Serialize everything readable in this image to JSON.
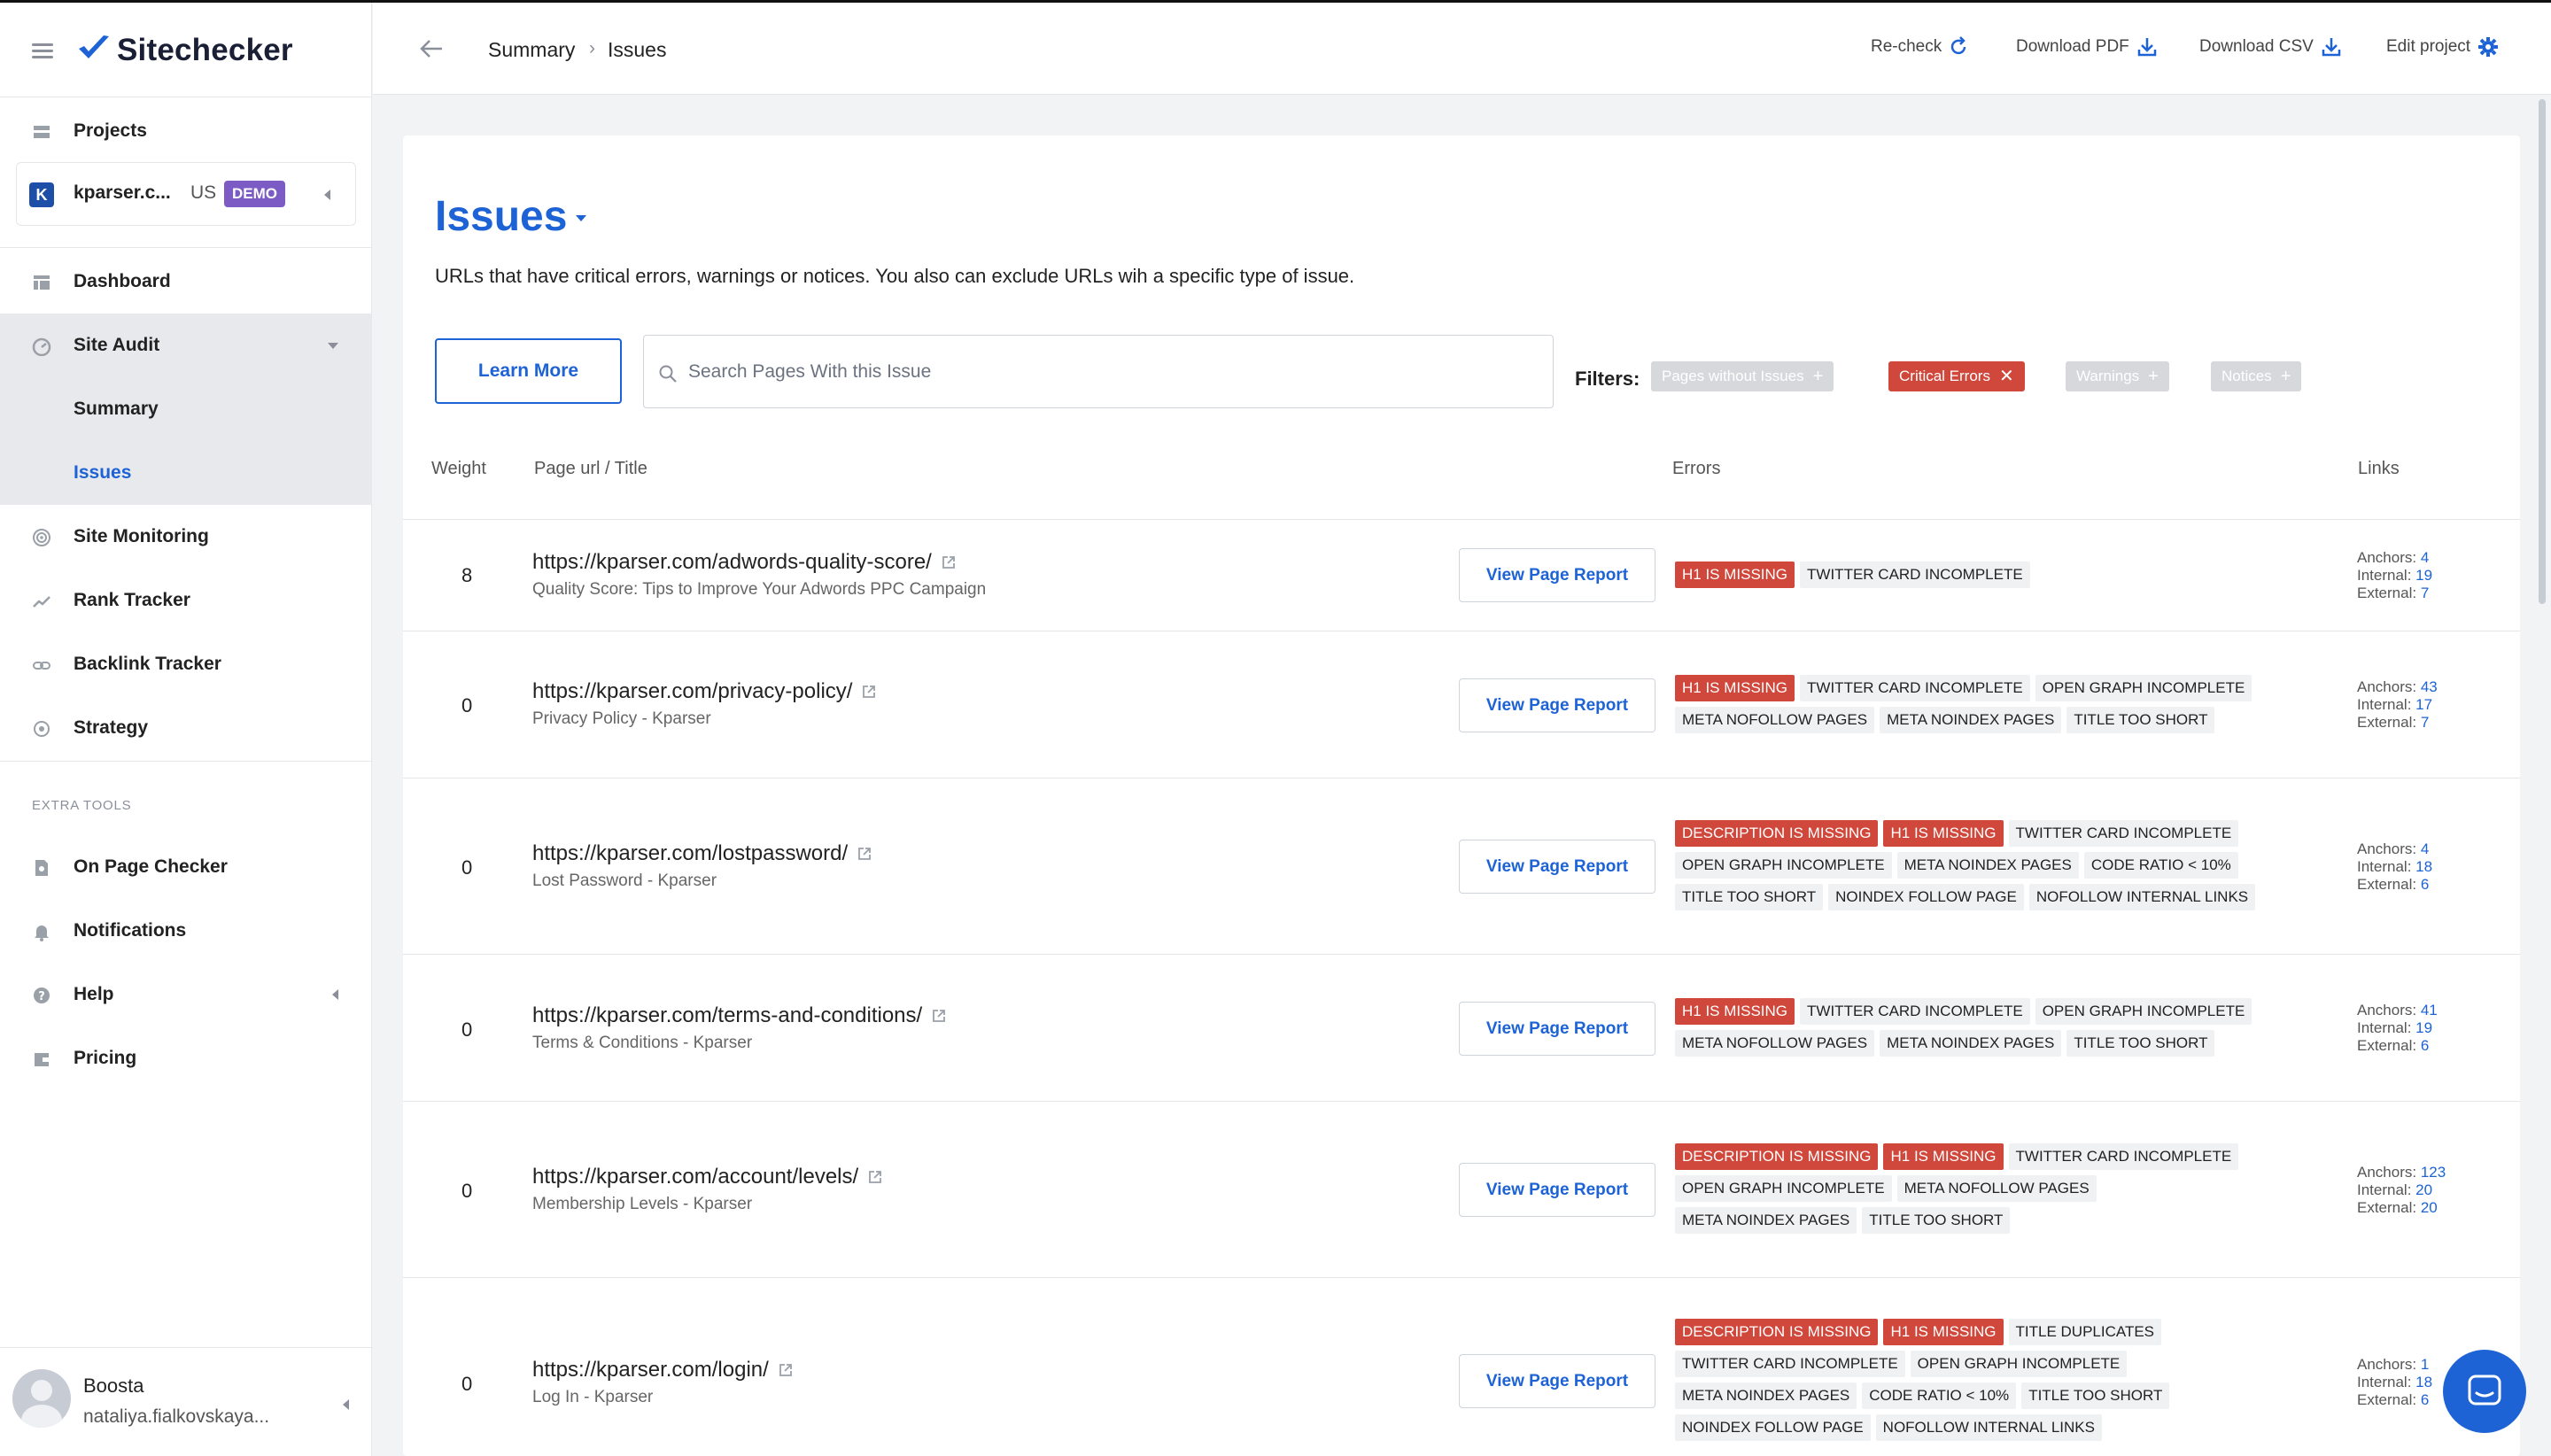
{
  "app": {
    "name": "Sitechecker"
  },
  "sidebar": {
    "projects_label": "Projects",
    "project": {
      "initial": "K",
      "name": "kparser.c...",
      "country": "US",
      "badge": "DEMO"
    },
    "nav": {
      "dashboard": "Dashboard",
      "site_audit": "Site Audit",
      "summary": "Summary",
      "issues": "Issues",
      "site_monitoring": "Site Monitoring",
      "rank_tracker": "Rank Tracker",
      "backlink_tracker": "Backlink Tracker",
      "strategy": "Strategy"
    },
    "extra_tools_label": "EXTRA TOOLS",
    "extra": {
      "on_page_checker": "On Page Checker",
      "notifications": "Notifications",
      "help": "Help",
      "pricing": "Pricing"
    },
    "user": {
      "name": "Boosta",
      "email": "nataliya.fialkovskaya..."
    }
  },
  "topbar": {
    "breadcrumb": [
      "Summary",
      "Issues"
    ],
    "actions": {
      "recheck": "Re-check",
      "pdf": "Download PDF",
      "csv": "Download CSV",
      "edit": "Edit project"
    }
  },
  "main": {
    "title": "Issues",
    "description": "URLs that have critical errors, warnings or notices. You also can exclude URLs wih a specific type of issue.",
    "learn_more": "Learn More",
    "search_placeholder": "Search Pages With this Issue",
    "filters_label": "Filters:",
    "filters": [
      {
        "label": "Pages without Issues",
        "active": false
      },
      {
        "label": "Critical Errors",
        "active": true
      },
      {
        "label": "Warnings",
        "active": false
      },
      {
        "label": "Notices",
        "active": false
      }
    ],
    "columns": {
      "weight": "Weight",
      "page": "Page url / Title",
      "errors": "Errors",
      "links": "Links"
    },
    "view_report_label": "View Page Report",
    "links_labels": {
      "anchors": "Anchors:",
      "internal": "Internal:",
      "external": "External:"
    },
    "rows": [
      {
        "weight": "8",
        "url": "https://kparser.com/adwords-quality-score/",
        "title": "Quality Score: Tips to Improve Your Adwords PPC Campaign",
        "errors": [
          "H1 IS MISSING"
        ],
        "warnings": [
          "TWITTER CARD INCOMPLETE"
        ],
        "anchors": "4",
        "internal": "19",
        "external": "7"
      },
      {
        "weight": "0",
        "url": "https://kparser.com/privacy-policy/",
        "title": "Privacy Policy - Kparser",
        "errors": [
          "H1 IS MISSING"
        ],
        "warnings": [
          "TWITTER CARD INCOMPLETE",
          "OPEN GRAPH INCOMPLETE",
          "META NOFOLLOW PAGES",
          "META NOINDEX PAGES",
          "TITLE TOO SHORT"
        ],
        "anchors": "43",
        "internal": "17",
        "external": "7"
      },
      {
        "weight": "0",
        "url": "https://kparser.com/lostpassword/",
        "title": "Lost Password - Kparser",
        "errors": [
          "DESCRIPTION IS MISSING",
          "H1 IS MISSING"
        ],
        "warnings": [
          "TWITTER CARD INCOMPLETE",
          "OPEN GRAPH INCOMPLETE",
          "META NOINDEX PAGES",
          "CODE RATIO < 10%",
          "TITLE TOO SHORT",
          "NOINDEX FOLLOW PAGE",
          "NOFOLLOW INTERNAL LINKS"
        ],
        "anchors": "4",
        "internal": "18",
        "external": "6"
      },
      {
        "weight": "0",
        "url": "https://kparser.com/terms-and-conditions/",
        "title": "Terms & Conditions - Kparser",
        "errors": [
          "H1 IS MISSING"
        ],
        "warnings": [
          "TWITTER CARD INCOMPLETE",
          "OPEN GRAPH INCOMPLETE",
          "META NOFOLLOW PAGES",
          "META NOINDEX PAGES",
          "TITLE TOO SHORT"
        ],
        "anchors": "41",
        "internal": "19",
        "external": "6"
      },
      {
        "weight": "0",
        "url": "https://kparser.com/account/levels/",
        "title": "Membership Levels - Kparser",
        "errors": [
          "DESCRIPTION IS MISSING",
          "H1 IS MISSING"
        ],
        "warnings": [
          "TWITTER CARD INCOMPLETE",
          "OPEN GRAPH INCOMPLETE",
          "META NOFOLLOW PAGES",
          "META NOINDEX PAGES",
          "TITLE TOO SHORT"
        ],
        "anchors": "123",
        "internal": "20",
        "external": "20"
      },
      {
        "weight": "0",
        "url": "https://kparser.com/login/",
        "title": "Log In - Kparser",
        "errors": [
          "DESCRIPTION IS MISSING",
          "H1 IS MISSING"
        ],
        "warnings": [
          "TITLE DUPLICATES",
          "TWITTER CARD INCOMPLETE",
          "OPEN GRAPH INCOMPLETE",
          "META NOINDEX PAGES",
          "CODE RATIO < 10%",
          "TITLE TOO SHORT",
          "NOINDEX FOLLOW PAGE",
          "NOFOLLOW INTERNAL LINKS"
        ],
        "anchors": "1",
        "internal": "18",
        "external": "6"
      }
    ]
  },
  "icons": {
    "menu": "hamburger-icon",
    "logo": "checkmark-logo-icon",
    "back": "arrow-left-icon",
    "recheck": "refresh-icon",
    "download": "download-icon",
    "edit": "gear-icon",
    "search": "search-icon",
    "external": "external-link-icon",
    "chat": "chat-icon"
  },
  "colors": {
    "accent": "#1d63d6",
    "error": "#d0473b",
    "badge": "#7c5cc4"
  }
}
